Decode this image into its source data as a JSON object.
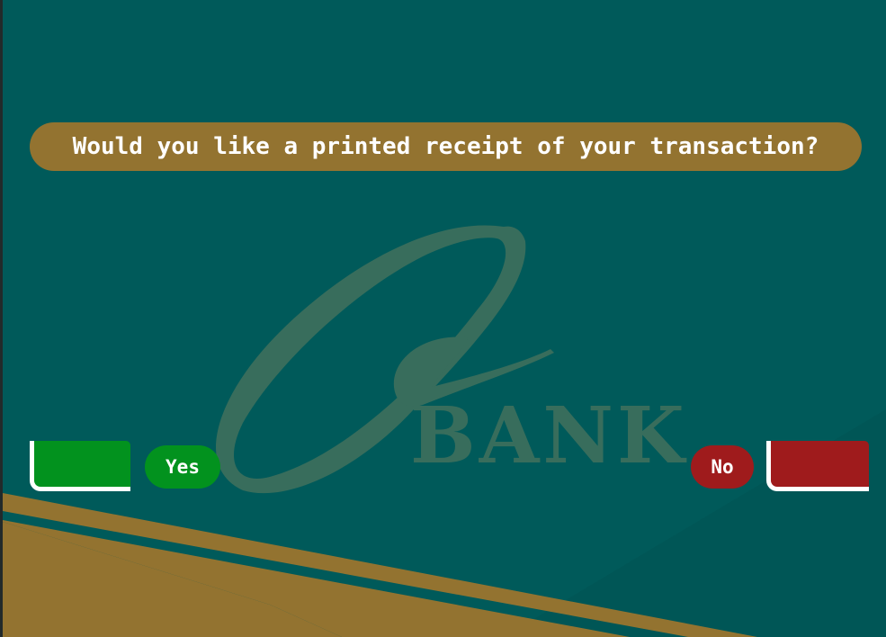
{
  "prompt": {
    "question": "Would you like a printed receipt of your transaction?"
  },
  "logo": {
    "text": "BANK"
  },
  "options": {
    "yes_label": "Yes",
    "no_label": "No"
  },
  "colors": {
    "background": "#005a5a",
    "accent_gold": "#937330",
    "yes_green": "#02921e",
    "no_red": "#9f1b1c",
    "logo_watermark": "#386d5c"
  }
}
